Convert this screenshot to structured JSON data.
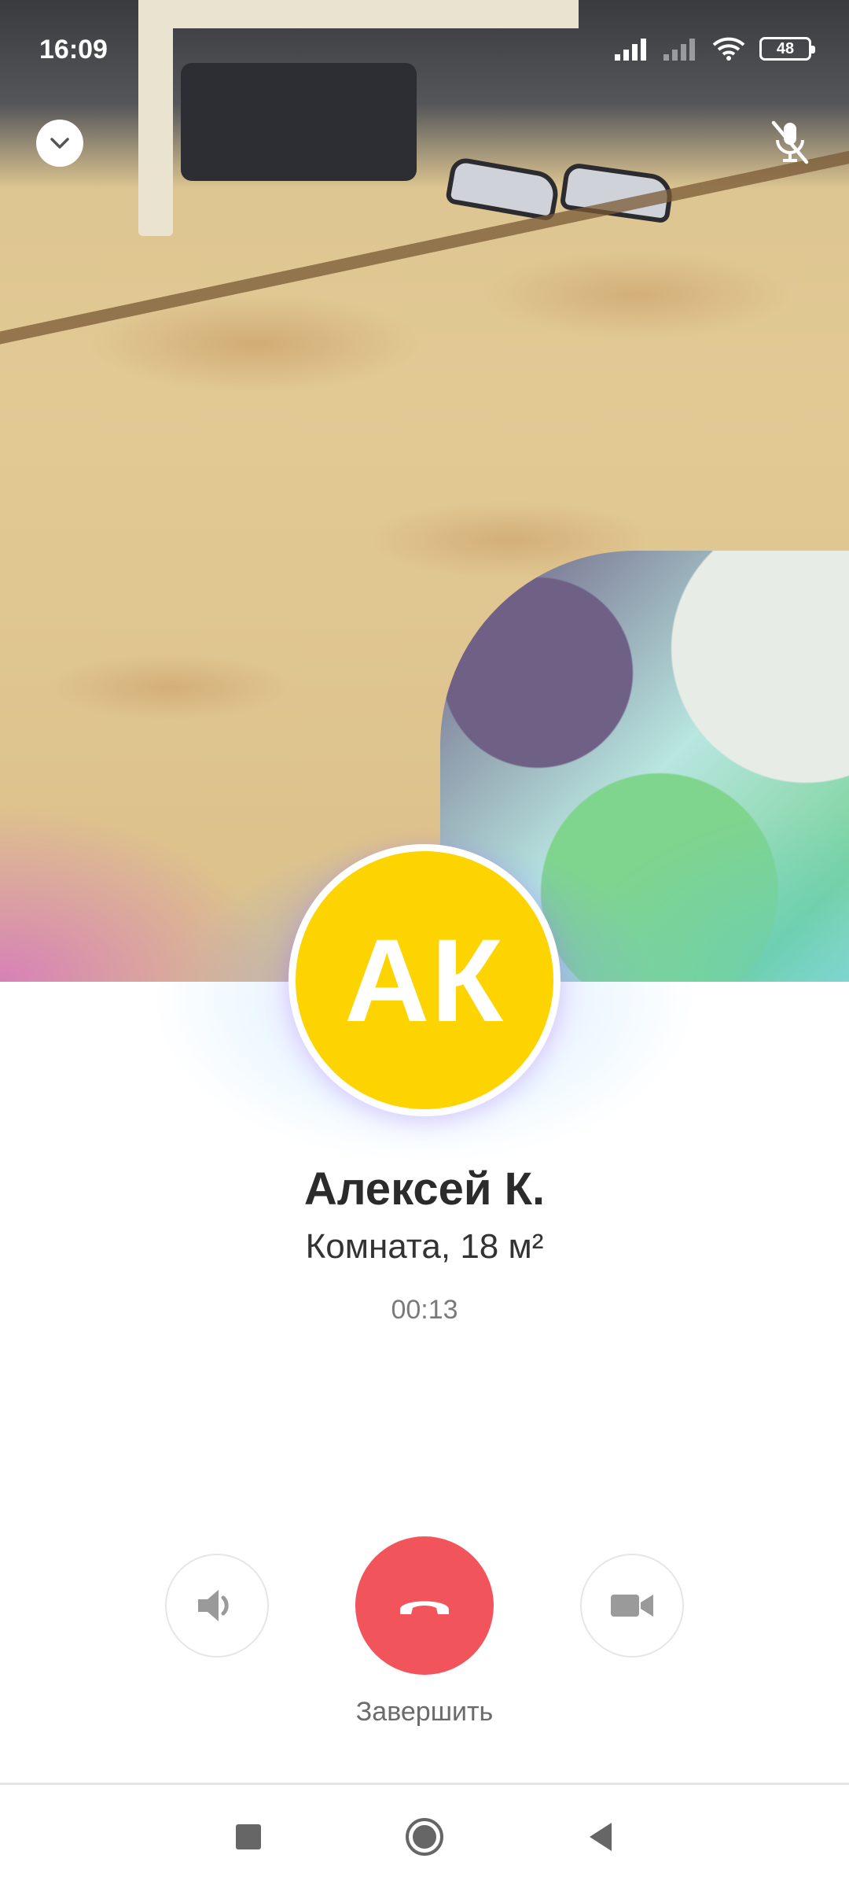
{
  "status_bar": {
    "time": "16:09",
    "battery_level": "48",
    "icons": [
      "signal-icon",
      "signal-off-icon",
      "wifi-icon",
      "battery-icon"
    ]
  },
  "top_controls": {
    "collapse_icon": "chevron-down-icon",
    "mute_icon": "mic-off-icon"
  },
  "caller": {
    "initials": "АК",
    "name": "Алексей К.",
    "subtitle": "Комната, 18 м²",
    "duration": "00:13",
    "avatar_color": "#fdd400"
  },
  "controls": {
    "speaker_icon": "speaker-icon",
    "video_icon": "video-camera-icon",
    "end_icon": "phone-hangup-icon",
    "end_label": "Завершить",
    "end_color": "#f2545b"
  },
  "nav": {
    "items": [
      "recents-icon",
      "home-icon",
      "back-icon"
    ]
  }
}
